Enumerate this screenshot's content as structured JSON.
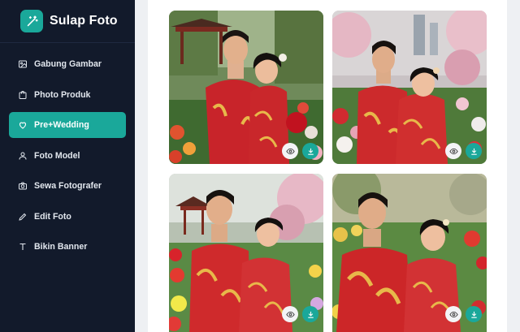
{
  "app": {
    "name": "Sulap Foto",
    "logo_icon": "magic-wand-icon"
  },
  "sidebar": {
    "items": [
      {
        "label": "Gabung Gambar",
        "icon": "image-icon",
        "active": false
      },
      {
        "label": "Photo Produk",
        "icon": "shopping-bag-icon",
        "active": false
      },
      {
        "label": "Pre+Wedding",
        "icon": "heart-icon",
        "active": true
      },
      {
        "label": "Foto Model",
        "icon": "user-icon",
        "active": false
      },
      {
        "label": "Sewa Fotografer",
        "icon": "camera-icon",
        "active": false
      },
      {
        "label": "Edit Foto",
        "icon": "pencil-icon",
        "active": false
      },
      {
        "label": "Bikin Banner",
        "icon": "text-icon",
        "active": false
      }
    ]
  },
  "gallery": {
    "photos": [
      {
        "alt": "couple-in-red-qipao-garden",
        "actions": [
          "eye-icon",
          "download-icon"
        ]
      },
      {
        "alt": "couple-in-red-qipao-blossom",
        "actions": [
          "eye-icon",
          "download-icon"
        ]
      },
      {
        "alt": "couple-in-red-qipao-pagoda",
        "actions": [
          "eye-icon",
          "download-icon"
        ]
      },
      {
        "alt": "couple-in-red-qipao-flowers",
        "actions": [
          "eye-icon",
          "download-icon"
        ]
      }
    ]
  },
  "colors": {
    "sidebar_bg": "#121a2b",
    "accent": "#1aa89a",
    "outfit_red": "#c8242a",
    "gold": "#e8b84a"
  }
}
